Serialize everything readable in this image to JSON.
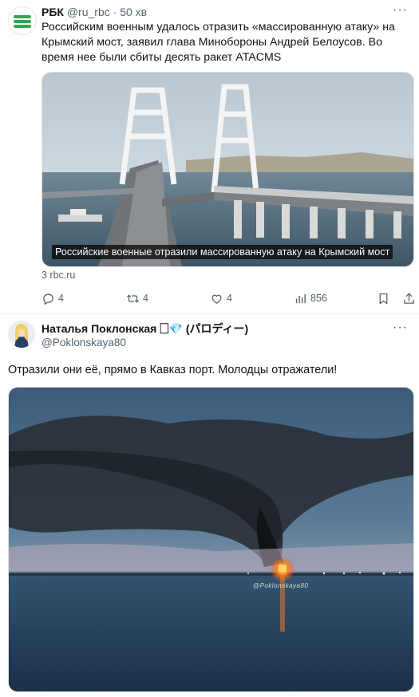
{
  "tweet1": {
    "author_name": "РБК",
    "handle": "@ru_rbc",
    "separator": "·",
    "time": "50 хв",
    "text": "Российским военным удалось отразить «массированную атаку» на Крымский мост, заявил глава Минобороны Андрей Белоусов. Во время нее были сбиты десять ракет ATACMS",
    "media_caption": "Российские военные отразили массированную атаку на Крымский мост",
    "link_domain": "3 rbc.ru",
    "replies": "4",
    "reposts": "4",
    "likes": "4",
    "views": "856",
    "more_glyph": "···"
  },
  "tweet2": {
    "author_name": "Наталья Поклонская 🗌💎 (パロディー)",
    "handle": "@Poklonskaya80",
    "text": "Отразили они её, прямо в Кавказ порт. Молодцы отражатели!",
    "media_watermark": "@Poklonskaya80",
    "more_glyph": "···"
  },
  "colors": {
    "text": "#0f1419",
    "muted": "#536471",
    "border": "#eff3f4",
    "rbc_green": "#35a651"
  },
  "icons": [
    "reply-icon",
    "repost-icon",
    "like-icon",
    "views-icon",
    "bookmark-icon",
    "share-icon",
    "more-icon"
  ]
}
